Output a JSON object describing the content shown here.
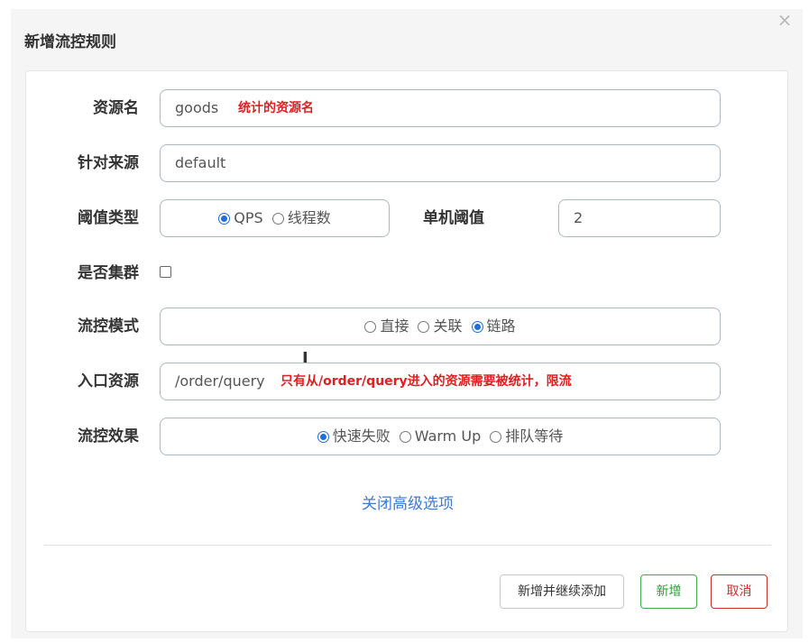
{
  "modal": {
    "title": "新增流控规则",
    "close_glyph": "×"
  },
  "form": {
    "resource_name": {
      "label": "资源名",
      "value": "goods",
      "annotation": "统计的资源名"
    },
    "limit_app": {
      "label": "针对来源",
      "value": "default"
    },
    "threshold_type": {
      "label": "阈值类型",
      "options": [
        "QPS",
        "线程数"
      ],
      "selected": "QPS"
    },
    "single_threshold": {
      "label": "单机阈值",
      "value": "2"
    },
    "cluster": {
      "label": "是否集群",
      "checked": false
    },
    "control_mode": {
      "label": "流控模式",
      "options": [
        "直接",
        "关联",
        "链路"
      ],
      "selected": "链路"
    },
    "entry_resource": {
      "label": "入口资源",
      "value": "/order/query",
      "annotation": "只有从/order/query进入的资源需要被统计，限流"
    },
    "control_effect": {
      "label": "流控效果",
      "options": [
        "快速失败",
        "Warm Up",
        "排队等待"
      ],
      "selected": "快速失败"
    },
    "advanced_toggle": "关闭高级选项"
  },
  "footer": {
    "add_continue_label": "新增并继续添加",
    "add_label": "新增",
    "cancel_label": "取消"
  },
  "colors": {
    "link": "#3a7bd5",
    "annotation": "#e02020",
    "add_button": "#2f9a38",
    "cancel_button": "#c9302c",
    "radio_selected": "#1e6fd9"
  }
}
